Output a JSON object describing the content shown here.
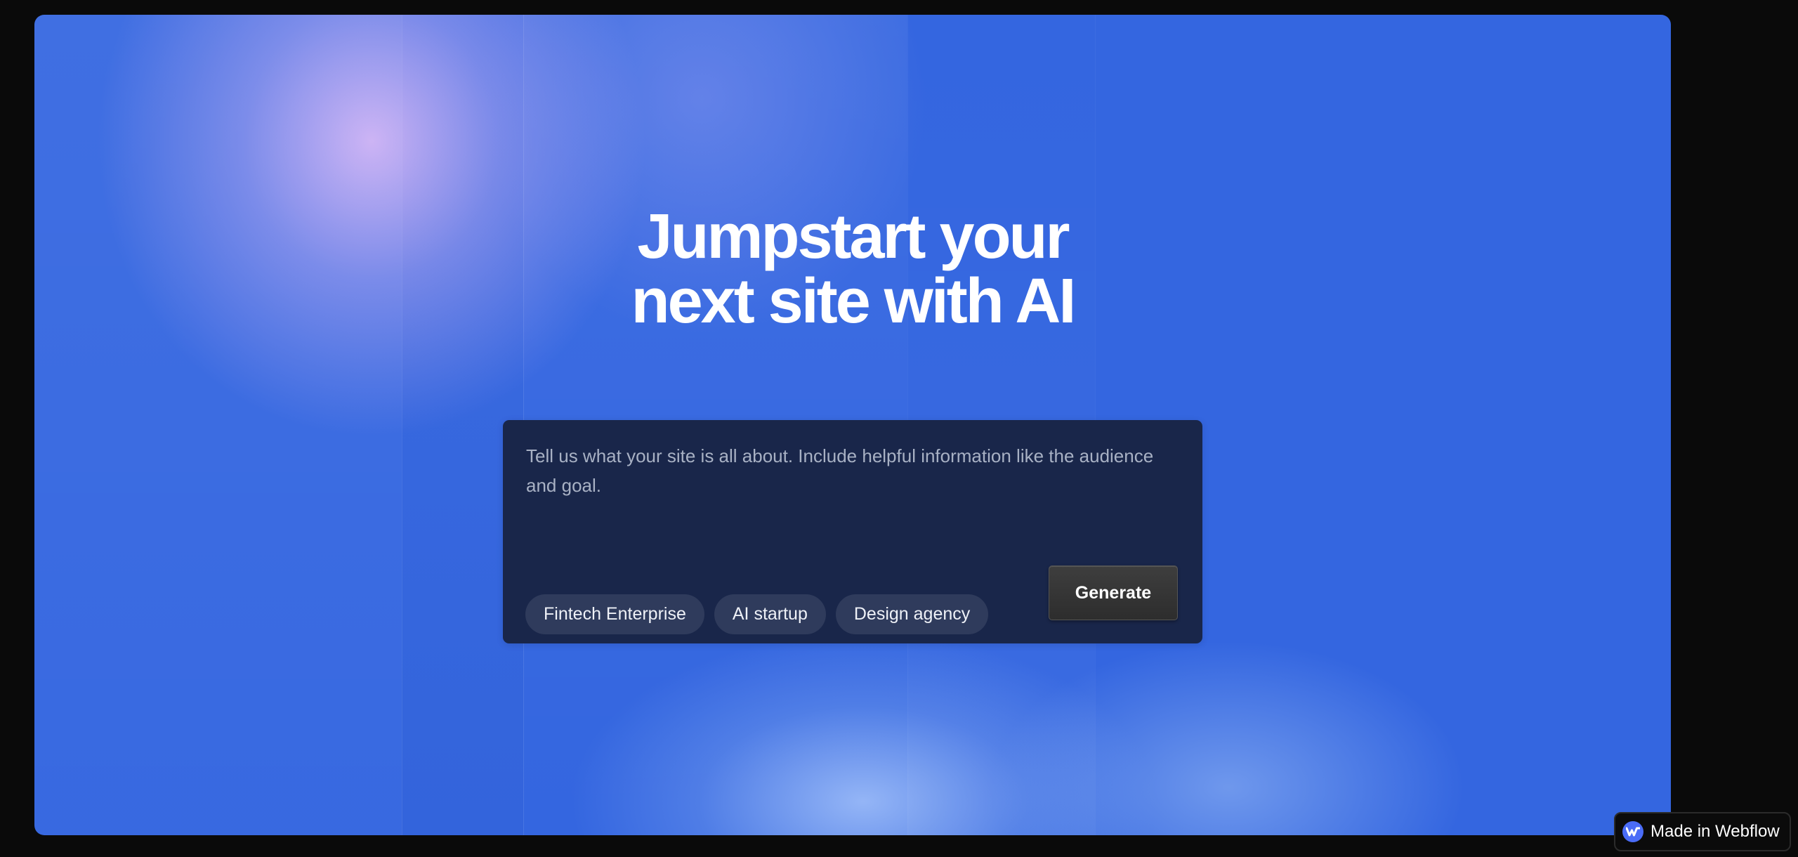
{
  "hero": {
    "headline_line1": "Jumpstart your",
    "headline_line2": "next site with AI"
  },
  "prompt": {
    "placeholder": "Tell us what your site is all about. Include helpful information like the audience and goal.",
    "value": "",
    "suggestions": [
      {
        "label": "Fintech Enterprise"
      },
      {
        "label": "AI startup"
      },
      {
        "label": "Design agency"
      }
    ],
    "generate_label": "Generate"
  },
  "badge": {
    "label": "Made in Webflow",
    "icon": "webflow-logo-icon"
  },
  "colors": {
    "page_background": "#0a0a0a",
    "hero_blue": "#3466e0",
    "glow_lavender": "#d2b4f5",
    "card_navy": "#19264a",
    "chip_background": "#2f3b5c",
    "button_dark": "#353535",
    "webflow_blue": "#4a6cf7"
  }
}
